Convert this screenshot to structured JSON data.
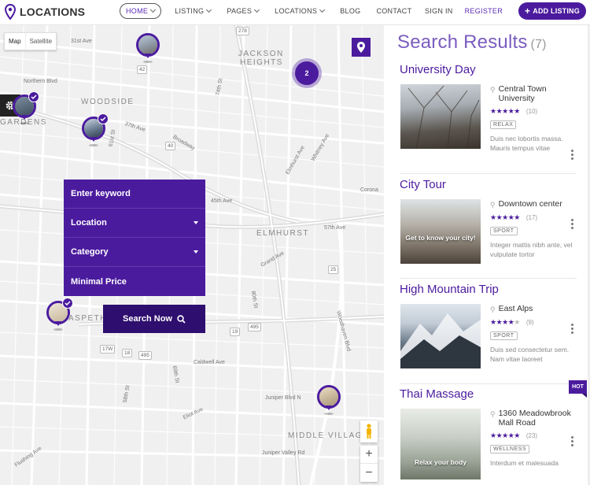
{
  "header": {
    "logo_text": "LOCATIONS",
    "nav": [
      {
        "label": "HOME",
        "dropdown": true,
        "active": true
      },
      {
        "label": "LISTING",
        "dropdown": true
      },
      {
        "label": "PAGES",
        "dropdown": true
      },
      {
        "label": "LOCATIONS",
        "dropdown": true
      },
      {
        "label": "BLOG",
        "dropdown": false
      },
      {
        "label": "CONTACT",
        "dropdown": false
      }
    ],
    "sign_in": "SIGN IN",
    "register": "REGISTER",
    "add_listing": "ADD LISTING"
  },
  "colors": {
    "accent": "#4b1b9e",
    "accent_dark": "#2e0e6e",
    "title": "#7a5cbf"
  },
  "map": {
    "type_map": "Map",
    "type_satellite": "Satellite",
    "cluster_count": "2",
    "area_labels": {
      "jackson": "JACKSON",
      "heights": "HEIGHTS",
      "woodside": "WOODSIDE",
      "gardens": "GARDENS",
      "elmhurst": "ELMHURST",
      "maspeth": "ASPETH",
      "middle_village": "MIDDLE VILLAG"
    },
    "street_labels": {
      "s31": "31st Ave",
      "northern": "Northern Blvd",
      "s37": "37th Ave",
      "broadway": "Broadway",
      "s45": "45th Ave",
      "s57": "57th Ave",
      "grand": "Grand Ave",
      "s69": "69th St",
      "caldwell": "Caldwell Ave",
      "eliot": "Eliot Ave",
      "juniper": "Juniper Blvd N",
      "juniper_valley": "Juniper Valley Rd",
      "flushing": "Flushing Ave",
      "woodhaven": "Woodhaven Blvd",
      "corona": "Corona",
      "elmhurst_ave": "Elmhurst Ave",
      "whitney": "Whitney Ave",
      "hoyt": "Hoyt Ave",
      "s80": "80th St",
      "s74": "74th St",
      "s61": "61st St",
      "s58": "58th St"
    },
    "shields": {
      "r1": "42",
      "r2": "40",
      "r3": "25",
      "r4": "495",
      "r5": "19",
      "r6": "17W",
      "r7": "18",
      "r8": "495",
      "r9": "278"
    }
  },
  "search": {
    "keyword": "Enter keyword",
    "location": "Location",
    "category": "Category",
    "min_price": "Minimal Price",
    "button": "Search Now"
  },
  "results": {
    "heading": "Search Results",
    "count": "(7)",
    "items": [
      {
        "title": "University Day",
        "location": "Central Town University",
        "rating": 5,
        "reviews": "(10)",
        "tag": "RELAX",
        "desc": "Duis nec lobortis massa. Mauris tempus vitae",
        "caption": ""
      },
      {
        "title": "City Tour",
        "location": "Downtown center",
        "rating": 5,
        "reviews": "(17)",
        "tag": "SPORT",
        "desc": "Integer mattis nibh ante, vel vulputate tortor",
        "caption": "Get to know your city!"
      },
      {
        "title": "High Mountain Trip",
        "location": "East Alps",
        "rating": 4,
        "reviews": "(9)",
        "tag": "SPORT",
        "desc": "Duis sed consectetur sem. Nam vitae laoreet",
        "caption": ""
      },
      {
        "title": "Thai Massage",
        "location": "1360 Meadowbrook Mall Road",
        "rating": 5,
        "reviews": "(23)",
        "tag": "WELLNESS",
        "desc": "Interdum et malesuada",
        "caption": "Relax your body",
        "badge": "HOT"
      }
    ]
  }
}
